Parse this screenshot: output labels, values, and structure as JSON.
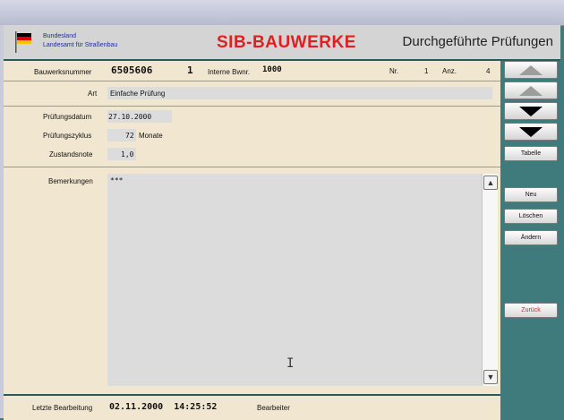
{
  "header": {
    "agency_line1": "Bundesland",
    "agency_line2": "Landesamt für Straßenbau",
    "app_title": "SIB-BAUWERKE",
    "section_title": "Durchgeführte Prüfungen"
  },
  "record": {
    "bauwerksnummer_label": "Bauwerksnummer",
    "bauwerksnummer_value": "6505606",
    "teil_value": "1",
    "interne_label": "Interne Bwnr.",
    "interne_value": "1000",
    "nr_label": "Nr.",
    "nr_value": "1",
    "anz_label": "Anz.",
    "anz_value": "4"
  },
  "form": {
    "art_label": "Art",
    "art_value": "Einfache Prüfung",
    "datum_label": "Prüfungsdatum",
    "datum_value": "27.10.2000",
    "zyklus_label": "Prüfungszyklus",
    "zyklus_value": "72",
    "zyklus_unit": "Monate",
    "note_label": "Zustandsnote",
    "note_value": "1,0",
    "bemerkungen_label": "Bemerkungen",
    "bemerkungen_value": "***"
  },
  "buttons": {
    "tabelle": "Tabelle",
    "neu": "Neu",
    "loeschen": "Löschen",
    "aendern": "Ändern",
    "zurueck": "Zurück"
  },
  "footer": {
    "letzte_label": "Letzte Bearbeitung",
    "letzte_value": "02.11.2000  14:25:52",
    "bearbeiter_label": "Bearbeiter"
  },
  "colors": {
    "title_red": "#e02020",
    "panel": "#f1e7d0",
    "teal": "#3f7a7c"
  }
}
